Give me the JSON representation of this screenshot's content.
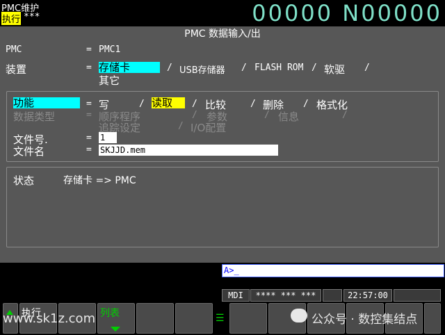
{
  "header": {
    "mode": "PMC维护",
    "exec_tag": "执行",
    "exec_stars": "***",
    "counter": "00000 N00000"
  },
  "screen": {
    "title": "PMC 数据输入/出",
    "pmc_label": "PMC",
    "pmc_eq": "=",
    "pmc_value": "PMC1",
    "device_label": "装置",
    "device_eq": "=",
    "device_options": [
      "存储卡",
      "USB存储器",
      "FLASH ROM",
      "软驱",
      "其它"
    ],
    "device_selected": "存储卡",
    "sep": "/",
    "func_label": "功能",
    "func_eq": "=",
    "func_options": [
      "写",
      "读取",
      "比较",
      "删除",
      "格式化"
    ],
    "func_selected": "读取",
    "datatype_label": "数据类型",
    "datatype_eq": "=",
    "datatype_options": [
      "顺序程序",
      "参数",
      "信息",
      "追踪设定",
      "I/O配置"
    ],
    "fileno_label": "文件号.",
    "fileno_eq": "=",
    "fileno_value": "1",
    "filename_label": "文件名",
    "filename_eq": "=",
    "filename_value": "SKJJD.mem",
    "status_label": "状态",
    "status_value": "存储卡 => PMC"
  },
  "bottom": {
    "cmd_prompt": "A>_",
    "mdi": "MDI",
    "stars": "**** *** ***",
    "time": "22:57:00",
    "softkeys": [
      "执行",
      "列表"
    ],
    "watermark_left": "www.sk1z.com",
    "watermark_right": "公众号 · 数控集结点"
  }
}
